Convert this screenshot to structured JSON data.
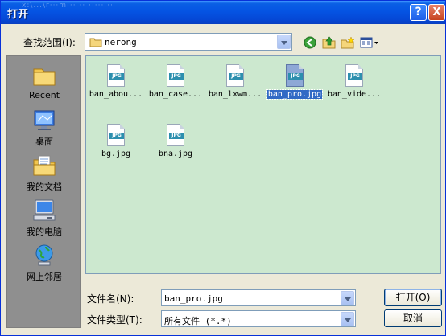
{
  "window": {
    "title": "打开",
    "ghost_title": "x:\\...\\r···m···  ·· ····· ··",
    "help_label": "?",
    "close_label": "X"
  },
  "lookin": {
    "label": "查找范围(I):",
    "value": "nerong"
  },
  "places": [
    {
      "label": "Recent",
      "icon": "recent-folder-icon"
    },
    {
      "label": "桌面",
      "icon": "desktop-icon"
    },
    {
      "label": "我的文档",
      "icon": "my-documents-icon"
    },
    {
      "label": "我的电脑",
      "icon": "my-computer-icon"
    },
    {
      "label": "网上邻居",
      "icon": "network-places-icon"
    }
  ],
  "files": [
    {
      "name": "ban_abou...",
      "badge": "JPG",
      "selected": false
    },
    {
      "name": "ban_case...",
      "badge": "JPG",
      "selected": false
    },
    {
      "name": "ban_lxwm...",
      "badge": "JPG",
      "selected": false
    },
    {
      "name": "ban_pro.jpg",
      "badge": "JPG",
      "selected": true
    },
    {
      "name": "ban_vide...",
      "badge": "JPG",
      "selected": false
    },
    {
      "name": "bg.jpg",
      "badge": "JPG",
      "selected": false
    },
    {
      "name": "bna.jpg",
      "badge": "JPG",
      "selected": false
    }
  ],
  "filename": {
    "label": "文件名(N):",
    "value": "ban_pro.jpg"
  },
  "filetype": {
    "label": "文件类型(T):",
    "value": "所有文件 (*.*)"
  },
  "buttons": {
    "open": "打开(O)",
    "cancel": "取消"
  },
  "colors": {
    "titlebar": "#0554e3",
    "file_area_bg": "#cce8cf",
    "places_bg": "#8f8f8f",
    "selection": "#316ac5"
  }
}
